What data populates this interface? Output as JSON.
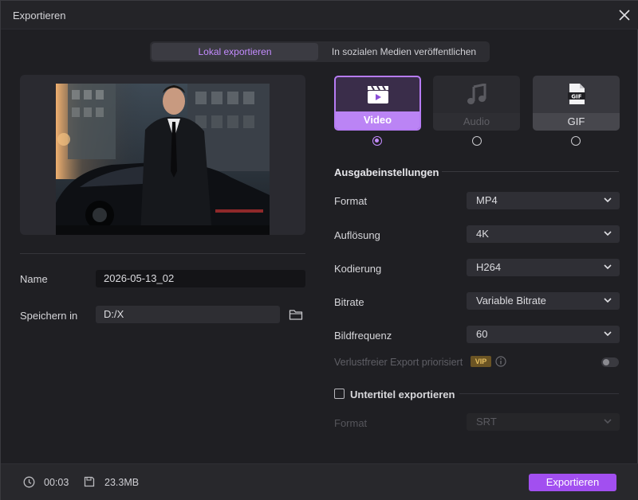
{
  "window": {
    "title": "Exportieren"
  },
  "tabs": [
    {
      "label": "Lokal exportieren",
      "active": true
    },
    {
      "label": "In sozialen Medien veröffentlichen",
      "active": false
    }
  ],
  "left": {
    "name_label": "Name",
    "name_value": "2026-05-13_02",
    "save_label": "Speichern in",
    "save_value": "D:/X"
  },
  "export_types": [
    {
      "label": "Video",
      "icon": "clapperboard-icon",
      "selected": true
    },
    {
      "label": "Audio",
      "icon": "music-note-icon",
      "selected": false
    },
    {
      "label": "GIF",
      "icon": "gif-file-icon",
      "selected": false
    }
  ],
  "settings": {
    "section_title": "Ausgabeinstellungen",
    "rows": [
      {
        "label": "Format",
        "value": "MP4"
      },
      {
        "label": "Auflösung",
        "value": "4K"
      },
      {
        "label": "Kodierung",
        "value": "H264"
      },
      {
        "label": "Bitrate",
        "value": "Variable Bitrate"
      },
      {
        "label": "Bildfrequenz",
        "value": "60"
      }
    ],
    "lossless_label": "Verlustfreier Export priorisiert",
    "vip_badge": "VIP",
    "subtitle_label": "Untertitel exportieren",
    "subtitle_format_label": "Format",
    "subtitle_format_value": "SRT"
  },
  "footer": {
    "duration": "00:03",
    "size": "23.3MB",
    "export_label": "Exportieren"
  },
  "colors": {
    "accent": "#a24ff0",
    "accent_light": "#c48cff",
    "background": "#1f1f23"
  }
}
